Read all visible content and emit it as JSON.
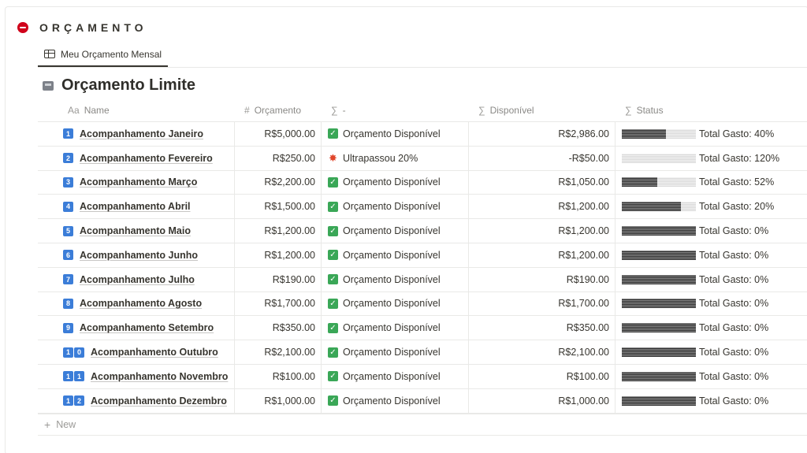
{
  "section": {
    "title": "ORÇAMENTO",
    "icon": "no-entry-icon"
  },
  "view_tab": {
    "label": "Meu Orçamento Mensal",
    "icon": "table-icon"
  },
  "database": {
    "title": "Orçamento Limite",
    "icon": "card-index-icon"
  },
  "columns": {
    "name": {
      "icon": "Aa",
      "label": "Name"
    },
    "orcamento": {
      "icon": "#",
      "label": "Orçamento"
    },
    "formula": {
      "icon": "∑",
      "label": "-"
    },
    "disponivel": {
      "icon": "∑",
      "label": "Disponível"
    },
    "status": {
      "icon": "∑",
      "label": "Status"
    }
  },
  "rows": [
    {
      "num": "1",
      "name": "Acompanhamento Janeiro",
      "orcamento": "R$5,000.00",
      "status_icon": "check",
      "formula": "Orçamento Disponível",
      "disponivel": "R$2,986.00",
      "gasto_pct": 40,
      "status_text": "Total Gasto: 40%"
    },
    {
      "num": "2",
      "name": "Acompanhamento Fevereiro",
      "orcamento": "R$250.00",
      "status_icon": "burst",
      "formula": "Ultrapassou 20%",
      "disponivel": "-R$50.00",
      "gasto_pct": 120,
      "status_text": "Total Gasto: 120%"
    },
    {
      "num": "3",
      "name": "Acompanhamento Março",
      "orcamento": "R$2,200.00",
      "status_icon": "check",
      "formula": "Orçamento Disponível",
      "disponivel": "R$1,050.00",
      "gasto_pct": 52,
      "status_text": "Total Gasto: 52%"
    },
    {
      "num": "4",
      "name": "Acompanhamento Abril",
      "orcamento": "R$1,500.00",
      "status_icon": "check",
      "formula": "Orçamento Disponível",
      "disponivel": "R$1,200.00",
      "gasto_pct": 20,
      "status_text": "Total Gasto: 20%"
    },
    {
      "num": "5",
      "name": "Acompanhamento Maio",
      "orcamento": "R$1,200.00",
      "status_icon": "check",
      "formula": "Orçamento Disponível",
      "disponivel": "R$1,200.00",
      "gasto_pct": 0,
      "status_text": "Total Gasto: 0%"
    },
    {
      "num": "6",
      "name": "Acompanhamento Junho",
      "orcamento": "R$1,200.00",
      "status_icon": "check",
      "formula": "Orçamento Disponível",
      "disponivel": "R$1,200.00",
      "gasto_pct": 0,
      "status_text": "Total Gasto: 0%"
    },
    {
      "num": "7",
      "name": "Acompanhamento Julho",
      "orcamento": "R$190.00",
      "status_icon": "check",
      "formula": "Orçamento Disponível",
      "disponivel": "R$190.00",
      "gasto_pct": 0,
      "status_text": "Total Gasto: 0%"
    },
    {
      "num": "8",
      "name": "Acompanhamento Agosto",
      "orcamento": "R$1,700.00",
      "status_icon": "check",
      "formula": "Orçamento Disponível",
      "disponivel": "R$1,700.00",
      "gasto_pct": 0,
      "status_text": "Total Gasto: 0%"
    },
    {
      "num": "9",
      "name": "Acompanhamento Setembro",
      "orcamento": "R$350.00",
      "status_icon": "check",
      "formula": "Orçamento Disponível",
      "disponivel": "R$350.00",
      "gasto_pct": 0,
      "status_text": "Total Gasto: 0%"
    },
    {
      "num": "10",
      "name": "Acompanhamento Outubro",
      "orcamento": "R$2,100.00",
      "status_icon": "check",
      "formula": "Orçamento Disponível",
      "disponivel": "R$2,100.00",
      "gasto_pct": 0,
      "status_text": "Total Gasto: 0%"
    },
    {
      "num": "11",
      "name": "Acompanhamento Novembro",
      "orcamento": "R$100.00",
      "status_icon": "check",
      "formula": "Orçamento Disponível",
      "disponivel": "R$100.00",
      "gasto_pct": 0,
      "status_text": "Total Gasto: 0%"
    },
    {
      "num": "12",
      "name": "Acompanhamento Dezembro",
      "orcamento": "R$1,000.00",
      "status_icon": "check",
      "formula": "Orçamento Disponível",
      "disponivel": "R$1,000.00",
      "gasto_pct": 0,
      "status_text": "Total Gasto: 0%"
    }
  ],
  "new_row": {
    "label": "New"
  },
  "colors": {
    "keycap_blue": "#3b7dd8",
    "check_green": "#3aa757",
    "alert_red": "#e0452a",
    "header_icon_red": "#d0021b"
  }
}
